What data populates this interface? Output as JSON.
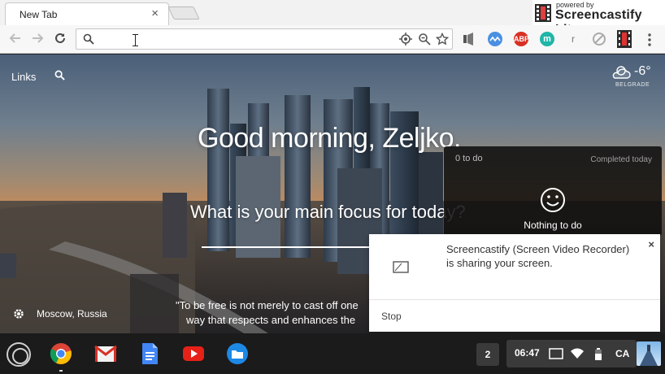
{
  "browser": {
    "tab_title": "New Tab",
    "tab_close": "×",
    "screencastify_badge": {
      "small": "powered by",
      "big": "Screencastify Lite"
    },
    "omnibox_value": "",
    "extensions": [
      {
        "name": "screencastify-ext-icon",
        "label": ""
      },
      {
        "name": "momentum-ext-icon",
        "label": ""
      },
      {
        "name": "adblock-ext-icon",
        "label": "ABP"
      },
      {
        "name": "m-ext-icon",
        "label": "m"
      },
      {
        "name": "r-ext-icon",
        "label": "r"
      },
      {
        "name": "blocked-ext-icon",
        "label": ""
      },
      {
        "name": "film-ext-icon",
        "label": ""
      }
    ]
  },
  "newtab": {
    "links_label": "Links",
    "temperature": "-6°",
    "city": "BELGRADE",
    "greeting": "Good morning, Zeljko.",
    "focus_question": "What is your main focus for today?",
    "location": "Moscow, Russia",
    "quote_line1": "\"To be free is not merely to cast off one",
    "quote_line2": "way that respects and enhances the"
  },
  "todo": {
    "count": "0 to do",
    "completed_label": "Completed today",
    "empty_text": "Nothing to do"
  },
  "notification": {
    "message": "Screencastify (Screen Video Recorder) is sharing your screen.",
    "close": "×",
    "stop_label": "Stop"
  },
  "shelf": {
    "apps": [
      "chrome-app-icon",
      "gmail-app-icon",
      "docs-app-icon",
      "youtube-app-icon",
      "files-app-icon"
    ],
    "notification_count": "2",
    "clock": "06:47",
    "ime": "CA"
  },
  "colors": {
    "accent_red": "#d93025",
    "chrome_green": "#34a853",
    "chrome_yellow": "#fbbc05",
    "chrome_blue": "#4285f4"
  }
}
